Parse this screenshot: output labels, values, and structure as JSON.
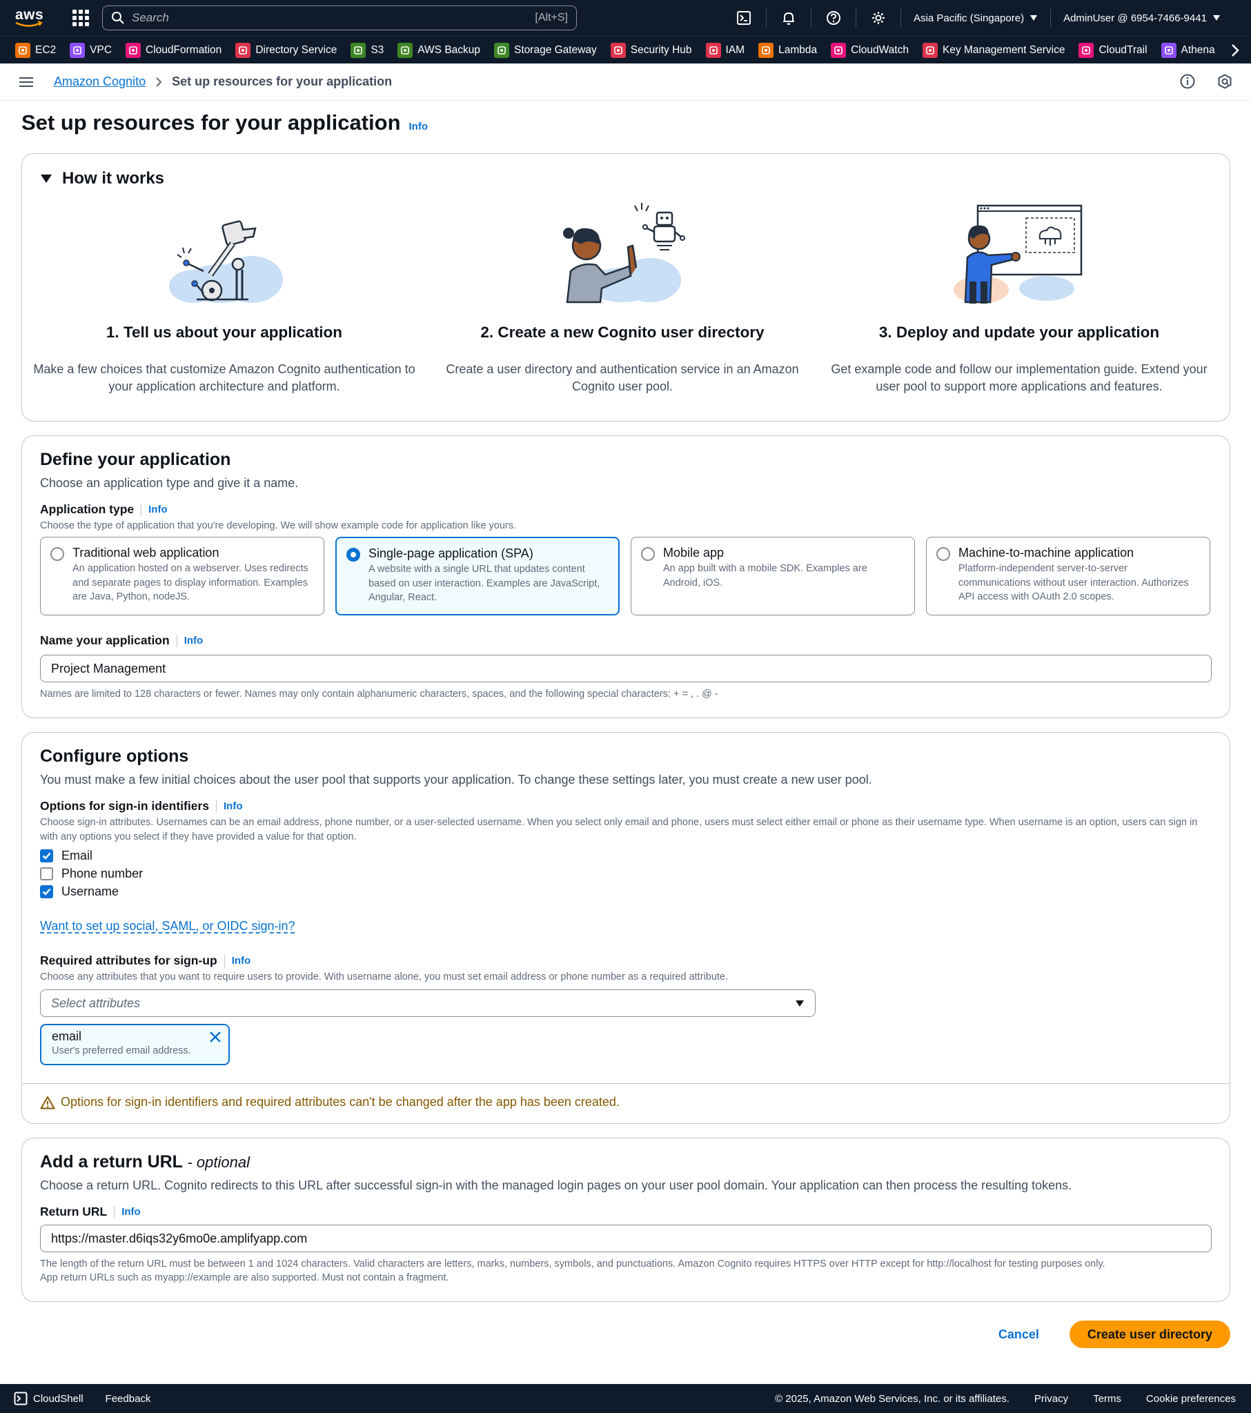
{
  "topnav": {
    "logo_text": "aws",
    "search_placeholder": "Search",
    "search_shortcut": "[Alt+S]",
    "region": "Asia Pacific (Singapore)",
    "account": "AdminUser @ 6954-7466-9441"
  },
  "favorites": [
    {
      "label": "EC2",
      "icon": "ec2-icon",
      "color": "#ed7100"
    },
    {
      "label": "VPC",
      "icon": "vpc-icon",
      "color": "#8c4fff"
    },
    {
      "label": "CloudFormation",
      "icon": "cloudformation-icon",
      "color": "#e7157b"
    },
    {
      "label": "Directory Service",
      "icon": "directory-service-icon",
      "color": "#dd344c"
    },
    {
      "label": "S3",
      "icon": "s3-icon",
      "color": "#3f8624"
    },
    {
      "label": "AWS Backup",
      "icon": "aws-backup-icon",
      "color": "#3f8624"
    },
    {
      "label": "Storage Gateway",
      "icon": "storage-gateway-icon",
      "color": "#3f8624"
    },
    {
      "label": "Security Hub",
      "icon": "security-hub-icon",
      "color": "#dd344c"
    },
    {
      "label": "IAM",
      "icon": "iam-icon",
      "color": "#dd344c"
    },
    {
      "label": "Lambda",
      "icon": "lambda-icon",
      "color": "#ed7100"
    },
    {
      "label": "CloudWatch",
      "icon": "cloudwatch-icon",
      "color": "#e7157b"
    },
    {
      "label": "Key Management Service",
      "icon": "kms-icon",
      "color": "#dd344c"
    },
    {
      "label": "CloudTrail",
      "icon": "cloudtrail-icon",
      "color": "#e7157b"
    },
    {
      "label": "Athena",
      "icon": "athena-icon",
      "color": "#8c4fff"
    }
  ],
  "breadcrumb": {
    "root": "Amazon Cognito",
    "current": "Set up resources for your application"
  },
  "page": {
    "title": "Set up resources for your application",
    "info": "Info"
  },
  "how": {
    "title": "How it works",
    "steps": [
      {
        "title": "1. Tell us about your application",
        "desc": "Make a few choices that customize Amazon Cognito authentication to your application architecture and platform."
      },
      {
        "title": "2. Create a new Cognito user directory",
        "desc": "Create a user directory and authentication service in an Amazon Cognito user pool."
      },
      {
        "title": "3. Deploy and update your application",
        "desc": "Get example code and follow our implementation guide. Extend your user pool to support more applications and features."
      }
    ]
  },
  "define": {
    "title": "Define your application",
    "desc": "Choose an application type and give it a name.",
    "type_label": "Application type",
    "type_desc": "Choose the type of application that you're developing. We will show example code for application like yours.",
    "types": [
      {
        "title": "Traditional web application",
        "desc": "An application hosted on a webserver. Uses redirects and separate pages to display information. Examples are Java, Python, nodeJS."
      },
      {
        "title": "Single-page application (SPA)",
        "desc": "A website with a single URL that updates content based on user interaction. Examples are JavaScript, Angular, React."
      },
      {
        "title": "Mobile app",
        "desc": "An app built with a mobile SDK. Examples are Android, iOS."
      },
      {
        "title": "Machine-to-machine application",
        "desc": "Platform-independent server-to-server communications without user interaction. Authorizes API access with OAuth 2.0 scopes."
      }
    ],
    "selected_type": "Single-page application (SPA)",
    "name_label": "Name your application",
    "name_value": "Project Management",
    "name_hint": "Names are limited to 128 characters or fewer. Names may only contain alphanumeric characters, spaces, and the following special characters: + = , . @ -"
  },
  "config": {
    "title": "Configure options",
    "desc": "You must make a few initial choices about the user pool that supports your application. To change these settings later, you must create a new user pool.",
    "signin_label": "Options for sign-in identifiers",
    "signin_desc": "Choose sign-in attributes. Usernames can be an email address, phone number, or a user-selected username. When you select only email and phone, users must select either email or phone as their username type. When username is an option, users can sign in with any options you select if they have provided a value for that option.",
    "identifiers": [
      {
        "label": "Email",
        "checked": true
      },
      {
        "label": "Phone number",
        "checked": false
      },
      {
        "label": "Username",
        "checked": true
      }
    ],
    "social_link": "Want to set up social, SAML, or OIDC sign-in?",
    "req_label": "Required attributes for sign-up",
    "req_desc": "Choose any attributes that you want to require users to provide. With username alone, you must set email address or phone number as a required attribute.",
    "select_placeholder": "Select attributes",
    "token_name": "email",
    "token_desc": "User's preferred email address.",
    "warning": "Options for sign-in identifiers and required attributes can't be changed after the app has been created."
  },
  "returnurl": {
    "title": "Add a return URL",
    "optional": "- optional",
    "desc": "Choose a return URL. Cognito redirects to this URL after successful sign-in with the managed login pages on your user pool domain. Your application can then process the resulting tokens.",
    "label": "Return URL",
    "value": "https://master.d6iqs32y6mo0e.amplifyapp.com",
    "hint1": "The length of the return URL must be between 1 and 1024 characters. Valid characters are letters, marks, numbers, symbols, and punctuations. Amazon Cognito requires HTTPS over HTTP except for http://localhost for testing purposes only.",
    "hint2": "App return URLs such as myapp://example are also supported. Must not contain a fragment."
  },
  "actions": {
    "cancel": "Cancel",
    "create": "Create user directory"
  },
  "footer": {
    "cloudshell": "CloudShell",
    "feedback": "Feedback",
    "copyright": "© 2025, Amazon Web Services, Inc. or its affiliates.",
    "privacy": "Privacy",
    "terms": "Terms",
    "cookies": "Cookie preferences"
  }
}
